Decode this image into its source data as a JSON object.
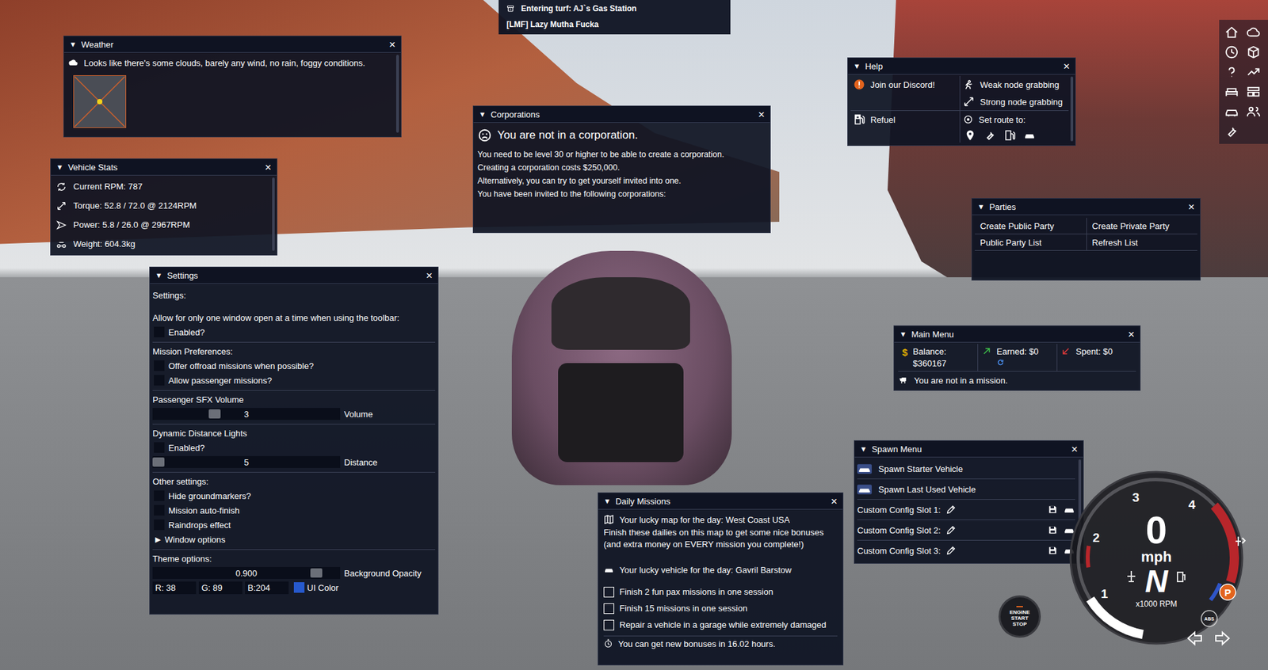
{
  "controls": {
    "collapse": "▼",
    "close": "×"
  },
  "banner": {
    "turf": "Entering turf: AJ`s Gas Station",
    "gang": "[LMF] Lazy Mutha Fucka"
  },
  "weather": {
    "title": "Weather",
    "text": "Looks like there's some clouds, barely any wind, no rain, foggy conditions."
  },
  "vehicle_stats": {
    "title": "Vehicle Stats",
    "rows": [
      "Current RPM: 787",
      "Torque: 52.8 / 72.0 @ 2124RPM",
      "Power: 5.8 / 26.0 @ 2967RPM",
      "Weight: 604.3kg"
    ]
  },
  "settings": {
    "title": "Settings",
    "sections": [
      {
        "items": [
          {
            "kind": "text",
            "text": "Settings:"
          },
          {
            "kind": "text",
            "text": "Allow for only one window open at a time when using the toolbar:"
          },
          {
            "kind": "checkbox",
            "label": "Enabled?",
            "checked": false
          }
        ]
      },
      {
        "items": [
          {
            "kind": "text",
            "text": "Mission Preferences:"
          },
          {
            "kind": "checkbox",
            "label": "Offer offroad missions when possible?",
            "checked": false
          },
          {
            "kind": "checkbox",
            "label": "Allow passenger missions?",
            "checked": false
          }
        ]
      },
      {
        "items": [
          {
            "kind": "text",
            "text": "Passenger SFX Volume"
          },
          {
            "kind": "slider",
            "value": "3",
            "label": "Volume",
            "level": 0.32
          }
        ]
      },
      {
        "items": [
          {
            "kind": "text",
            "text": "Dynamic Distance Lights"
          },
          {
            "kind": "checkbox",
            "label": "Enabled?",
            "checked": false
          },
          {
            "kind": "slider",
            "value": "5",
            "label": "Distance",
            "level": 0.0
          }
        ]
      },
      {
        "items": [
          {
            "kind": "text",
            "text": "Other settings:"
          },
          {
            "kind": "checkbox",
            "label": "Hide groundmarkers?",
            "checked": false
          },
          {
            "kind": "checkbox",
            "label": "Mission auto-finish",
            "checked": false
          },
          {
            "kind": "checkbox",
            "label": "Raindrops effect",
            "checked": false
          },
          {
            "kind": "tree",
            "glyph": "▶",
            "label": "Window options",
            "expanded": false
          }
        ]
      },
      {
        "items": [
          {
            "kind": "text",
            "text": "Theme options:"
          },
          {
            "kind": "slider",
            "value": "0.900",
            "label": "Background Opacity",
            "level": 0.9
          },
          {
            "kind": "color",
            "fields": [
              "R: 38",
              "G: 89",
              "B:204"
            ],
            "color": "#2659cc",
            "label": "UI Color"
          }
        ]
      }
    ]
  },
  "corporations": {
    "title": "Corporations",
    "heading": "You are not in a corporation.",
    "lines": [
      "You need to be level 30 or higher to be able to create a corporation.",
      "Creating a corporation costs $250,000.",
      "Alternatively, you can try to get yourself invited into one.",
      "You have been invited to the following corporations:"
    ]
  },
  "help": {
    "title": "Help",
    "discord": "Join our Discord!",
    "grabs": [
      "Weak node grabbing",
      "Strong node grabbing"
    ],
    "refuel": "Refuel",
    "route": "Set route to:"
  },
  "parties": {
    "title": "Parties",
    "buttons": [
      "Create Public Party",
      "Create Private Party",
      "Public Party List",
      "Refresh List"
    ]
  },
  "main_menu": {
    "title": "Main Menu",
    "balance_icon": "$",
    "balance_label": "Balance:",
    "balance": "$360167",
    "earned": "Earned: $0",
    "spent": "Spent: $0",
    "mission": "You are not in a mission."
  },
  "spawn_menu": {
    "title": "Spawn Menu",
    "rows": [
      {
        "kind": "action",
        "label": "Spawn Starter Vehicle"
      },
      {
        "kind": "action",
        "label": "Spawn Last Used Vehicle"
      },
      {
        "kind": "slot",
        "label": "Custom Config Slot 1:"
      },
      {
        "kind": "slot",
        "label": "Custom Config Slot 2:"
      },
      {
        "kind": "slot",
        "label": "Custom Config Slot 3:"
      }
    ]
  },
  "daily": {
    "title": "Daily Missions",
    "map": "Your lucky map for the day: West Coast USA",
    "description": "Finish these dailies on this map to get some nice bonuses (and extra money on EVERY mission you complete!)",
    "vehicle": "Your lucky vehicle for the day: Gavril Barstow",
    "tasks": [
      {
        "label": "Finish 2 fun pax missions in one session",
        "checked": false
      },
      {
        "label": "Finish 15 missions in one session",
        "checked": false
      },
      {
        "label": "Repair a vehicle in a garage while extremely damaged",
        "checked": false
      }
    ],
    "timer": "You can get new bonuses in 16.02 hours."
  },
  "gauge": {
    "ticks": [
      "1",
      "2",
      "3",
      "4"
    ],
    "speed": "0",
    "unit": "mph",
    "gear": "N",
    "rpm_label": "x1000 RPM",
    "rpm_level": 0.16,
    "parking": "P",
    "abs": "ABS"
  },
  "engine_button": [
    "ENGINE",
    "START",
    "STOP"
  ]
}
